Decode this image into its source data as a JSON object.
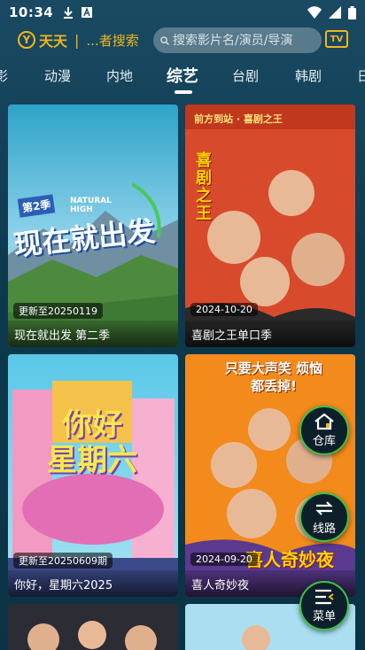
{
  "status_bar": {
    "time": "10:34"
  },
  "header": {
    "brand_name": "天天",
    "brand_separator": "|",
    "brand_sub": "...者搜索",
    "search_placeholder": "搜索影片名/演员/导演",
    "tv_label": "TV"
  },
  "tabs": [
    {
      "label": "影"
    },
    {
      "label": "动漫"
    },
    {
      "label": "内地"
    },
    {
      "label": "综艺",
      "active": true
    },
    {
      "label": "台剧"
    },
    {
      "label": "韩剧"
    },
    {
      "label": "日"
    }
  ],
  "cards": [
    {
      "badge": "更新至20250119",
      "title": "现在就出发 第二季",
      "poster_text_top": "第2季",
      "poster_text_main": "现在就出发",
      "poster_text_brand": "NATURAL HIGH"
    },
    {
      "badge": "2024-10-20",
      "title": "喜剧之王单口季",
      "poster_text_top": "前方到站 · 喜剧之王",
      "poster_text_main": "喜剧之王"
    },
    {
      "badge": "更新至20250609期",
      "title": "你好，星期六2025",
      "poster_text_main": "你好 星期六"
    },
    {
      "badge": "2024-09-20",
      "title": "喜人奇妙夜",
      "poster_text_top": "只要大声笑 烦恼都丢掉!",
      "poster_text_main": "喜人奇妙夜"
    }
  ],
  "fabs": {
    "warehouse": "仓库",
    "route": "线路",
    "menu": "菜单"
  },
  "colors": {
    "accent": "#f2b51d",
    "fab_border": "#39c54a"
  }
}
